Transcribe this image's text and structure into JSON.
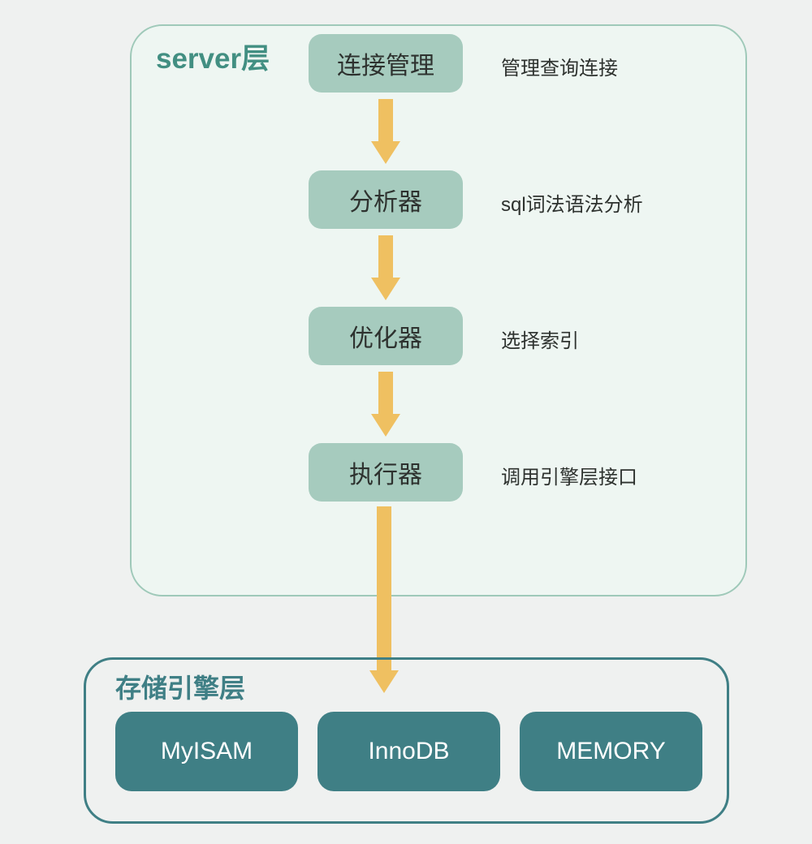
{
  "server": {
    "title": "server层",
    "steps": [
      {
        "name": "连接管理",
        "desc": "管理查询连接"
      },
      {
        "name": "分析器",
        "desc": "sql词法语法分析"
      },
      {
        "name": "优化器",
        "desc": "选择索引"
      },
      {
        "name": "执行器",
        "desc": "调用引擎层接口"
      }
    ]
  },
  "storage": {
    "title": "存储引擎层",
    "engines": [
      "MyISAM",
      "InnoDB",
      "MEMORY"
    ]
  },
  "colors": {
    "bg": "#eff1f0",
    "serverBorder": "#9fc9b9",
    "serverFill": "#eef6f2",
    "serverLabel": "#428f82",
    "flowBox": "#a6cbbe",
    "arrow": "#efc061",
    "engineBorder": "#3f7f85",
    "engineFill": "#3f7f85"
  }
}
